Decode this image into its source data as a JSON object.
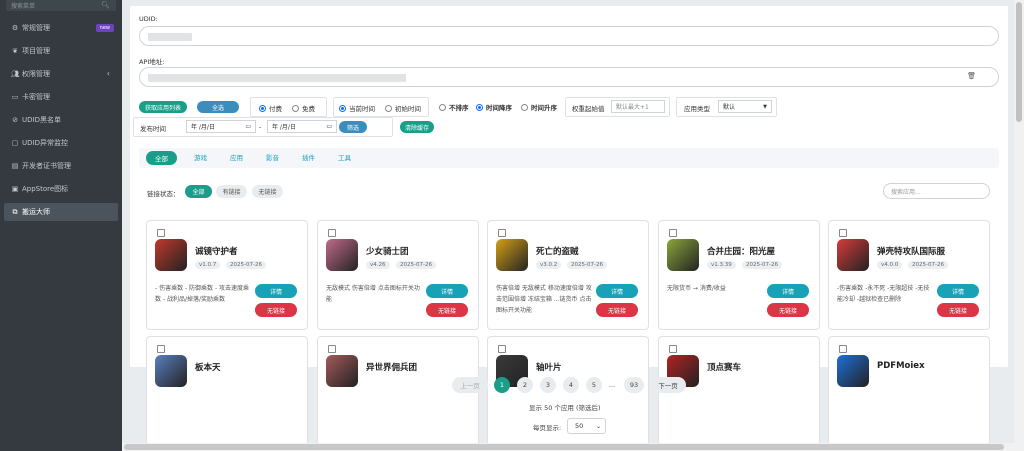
{
  "sidebar": {
    "search_placeholder": "搜索菜单",
    "items": [
      {
        "label": "常规管理",
        "badge": "new"
      },
      {
        "label": "项目管理"
      },
      {
        "label": "权限管理"
      },
      {
        "label": "卡密管理"
      },
      {
        "label": "UDID黑名单"
      },
      {
        "label": "UDID异常监控"
      },
      {
        "label": "开发者证书管理"
      },
      {
        "label": "AppStore图标"
      },
      {
        "label": "搬运大师"
      }
    ]
  },
  "form": {
    "udid_label": "UDID:",
    "api_label": "API地址:"
  },
  "filters": {
    "fetch_button": "获取应用列表",
    "select_all": "全选",
    "pay_paid": "付费",
    "pay_free": "免费",
    "time_current": "当前时间",
    "time_initial": "初始时间",
    "sort_none": "不排序",
    "sort_desc": "时间降序",
    "sort_asc": "时间升序",
    "weight_label": "权重起始值",
    "weight_placeholder": "默认最大+1",
    "apptype_label": "应用类型",
    "apptype_value": "默认",
    "publish_label": "发布时间",
    "date_placeholder": "年 /月/日",
    "date_sep": "-",
    "filter_button": "筛选",
    "clear_cache": "清除缓存"
  },
  "tabs": [
    "全部",
    "游戏",
    "应用",
    "影音",
    "插件",
    "工具"
  ],
  "link_status": {
    "label": "链接状态：",
    "chips": [
      "全部",
      "有链接",
      "无链接"
    ],
    "search_placeholder": "搜索应用..."
  },
  "apps": [
    {
      "name": "诚镜守护者",
      "version": "v1.0.7",
      "date": "2025-07-26",
      "desc": "- 伤害乘数 - 防御乘数 - 攻击速度乘数 - 战利品/掉落/奖励乘数",
      "details": "详情",
      "status": "无链接",
      "color": "#c0392b"
    },
    {
      "name": "少女骑士团",
      "version": "v4.26",
      "date": "2025-07-26",
      "desc": "无敌模式 伤害倍增 点击图标开关功能",
      "details": "详情",
      "status": "无链接",
      "color": "#c06b8a"
    },
    {
      "name": "死亡的盗贼",
      "version": "v3.0.2",
      "date": "2025-07-26",
      "desc": "伤害倍增 无敌模式 移动速度倍增 攻击范围倍增 冻结宝箱 ...链货币 点击图标开关功能",
      "details": "详情",
      "status": "无链接",
      "color": "#d4a017"
    },
    {
      "name": "合并庄园：阳光屋",
      "version": "v1.3.39",
      "date": "2025-07-26",
      "desc": "无限货币 → 消费/收益",
      "details": "详情",
      "status": "无链接",
      "color": "#8aa63c"
    },
    {
      "name": "弹壳特攻队国际服",
      "version": "v4.0.0",
      "date": "2025-07-26",
      "desc": "-伤害乘数 -永不死 -无限超技 -无技能冷却 -越狱检查已删除",
      "details": "详情",
      "status": "无链接",
      "color": "#d63b3b"
    },
    {
      "name": "板本天",
      "color": "#5a7fc0"
    },
    {
      "name": "异世界佣兵团",
      "color": "#a35a5a"
    },
    {
      "name": "轴叶片",
      "color": "#3a3a3a"
    },
    {
      "name": "顶点赛车",
      "color": "#b22222"
    },
    {
      "name": "PDFMoiex",
      "color": "#1e6fd9"
    }
  ],
  "pagination": {
    "prev": "上一页",
    "pages": [
      "1",
      "2",
      "3",
      "4",
      "5",
      "...",
      "93"
    ],
    "next": "下一页",
    "summary": "显示 50 个应用 (筛选后)",
    "per_page_label": "每页显示:",
    "per_page_value": "50"
  }
}
